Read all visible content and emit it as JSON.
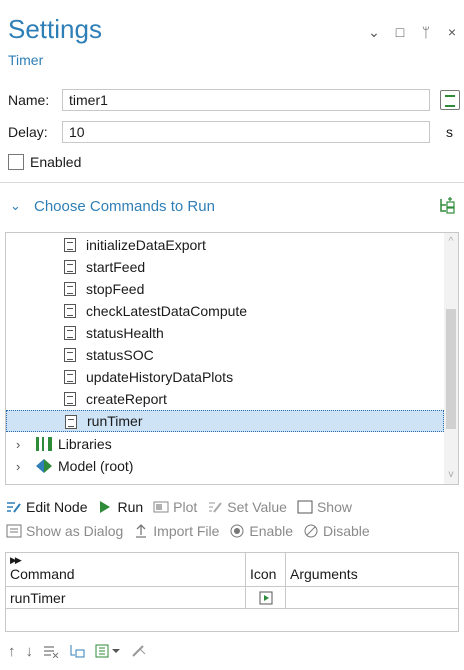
{
  "header": {
    "title": "Settings",
    "subtitle": "Timer"
  },
  "window_controls": {
    "dropdown": "⌄",
    "maximize": "□",
    "pin": "ᛘ",
    "close": "×"
  },
  "fields": {
    "name_label": "Name:",
    "name_value": "timer1",
    "delay_label": "Delay:",
    "delay_value": "10",
    "delay_unit": "s",
    "enabled_label": "Enabled",
    "enabled_checked": false
  },
  "section": {
    "title": "Choose Commands to Run",
    "expanded": true
  },
  "tree": {
    "methods": [
      {
        "label": "initializeDataExport"
      },
      {
        "label": "startFeed"
      },
      {
        "label": "stopFeed"
      },
      {
        "label": "checkLatestDataCompute"
      },
      {
        "label": "statusHealth"
      },
      {
        "label": "statusSOC"
      },
      {
        "label": "updateHistoryDataPlots"
      },
      {
        "label": "createReport"
      },
      {
        "label": "runTimer",
        "selected": true
      }
    ],
    "libraries_label": "Libraries",
    "model_label": "Model (root)"
  },
  "toolbar1": {
    "edit_node": "Edit Node",
    "run": "Run",
    "plot": "Plot",
    "set_value": "Set Value",
    "show": "Show"
  },
  "toolbar2": {
    "show_as_dialog": "Show as Dialog",
    "import_file": "Import File",
    "enable": "Enable",
    "disable": "Disable"
  },
  "grid": {
    "headers": [
      "Command",
      "Icon",
      "Arguments"
    ],
    "rows": [
      {
        "command": "runTimer",
        "icon": "run-icon",
        "arguments": ""
      }
    ]
  },
  "colors": {
    "accent": "#2f7fb7",
    "selection": "#cfe3f7",
    "green": "#2e8b3a"
  }
}
